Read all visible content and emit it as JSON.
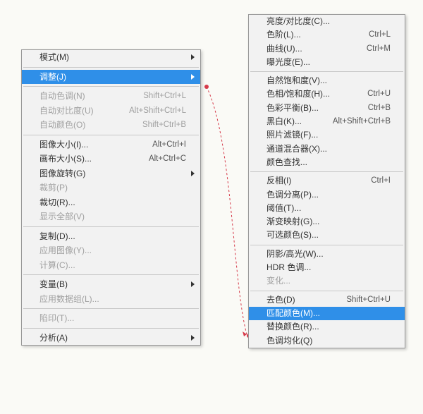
{
  "left_menu": {
    "groups": [
      [
        {
          "label": "模式(M)",
          "shortcut": "",
          "arrow": true,
          "disabled": false,
          "highlight": false,
          "name": "mode-item"
        }
      ],
      [
        {
          "label": "调整(J)",
          "shortcut": "",
          "arrow": true,
          "disabled": false,
          "highlight": true,
          "name": "adjustments-item"
        }
      ],
      [
        {
          "label": "自动色调(N)",
          "shortcut": "Shift+Ctrl+L",
          "arrow": false,
          "disabled": true,
          "highlight": false,
          "name": "auto-tone-item"
        },
        {
          "label": "自动对比度(U)",
          "shortcut": "Alt+Shift+Ctrl+L",
          "arrow": false,
          "disabled": true,
          "highlight": false,
          "name": "auto-contrast-item"
        },
        {
          "label": "自动颜色(O)",
          "shortcut": "Shift+Ctrl+B",
          "arrow": false,
          "disabled": true,
          "highlight": false,
          "name": "auto-color-item"
        }
      ],
      [
        {
          "label": "图像大小(I)...",
          "shortcut": "Alt+Ctrl+I",
          "arrow": false,
          "disabled": false,
          "highlight": false,
          "name": "image-size-item"
        },
        {
          "label": "画布大小(S)...",
          "shortcut": "Alt+Ctrl+C",
          "arrow": false,
          "disabled": false,
          "highlight": false,
          "name": "canvas-size-item"
        },
        {
          "label": "图像旋转(G)",
          "shortcut": "",
          "arrow": true,
          "disabled": false,
          "highlight": false,
          "name": "image-rotation-item"
        },
        {
          "label": "裁剪(P)",
          "shortcut": "",
          "arrow": false,
          "disabled": true,
          "highlight": false,
          "name": "crop-item"
        },
        {
          "label": "裁切(R)...",
          "shortcut": "",
          "arrow": false,
          "disabled": false,
          "highlight": false,
          "name": "trim-item"
        },
        {
          "label": "显示全部(V)",
          "shortcut": "",
          "arrow": false,
          "disabled": true,
          "highlight": false,
          "name": "reveal-all-item"
        }
      ],
      [
        {
          "label": "复制(D)...",
          "shortcut": "",
          "arrow": false,
          "disabled": false,
          "highlight": false,
          "name": "duplicate-item"
        },
        {
          "label": "应用图像(Y)...",
          "shortcut": "",
          "arrow": false,
          "disabled": true,
          "highlight": false,
          "name": "apply-image-item"
        },
        {
          "label": "计算(C)...",
          "shortcut": "",
          "arrow": false,
          "disabled": true,
          "highlight": false,
          "name": "calculations-item"
        }
      ],
      [
        {
          "label": "变量(B)",
          "shortcut": "",
          "arrow": true,
          "disabled": false,
          "highlight": false,
          "name": "variables-item"
        },
        {
          "label": "应用数据组(L)...",
          "shortcut": "",
          "arrow": false,
          "disabled": true,
          "highlight": false,
          "name": "apply-data-set-item"
        }
      ],
      [
        {
          "label": "陷印(T)...",
          "shortcut": "",
          "arrow": false,
          "disabled": true,
          "highlight": false,
          "name": "trap-item"
        }
      ],
      [
        {
          "label": "分析(A)",
          "shortcut": "",
          "arrow": true,
          "disabled": false,
          "highlight": false,
          "name": "analysis-item"
        }
      ]
    ]
  },
  "right_menu": {
    "groups": [
      [
        {
          "label": "亮度/对比度(C)...",
          "shortcut": "",
          "arrow": false,
          "disabled": false,
          "highlight": false,
          "name": "brightness-contrast-item"
        },
        {
          "label": "色阶(L)...",
          "shortcut": "Ctrl+L",
          "arrow": false,
          "disabled": false,
          "highlight": false,
          "name": "levels-item"
        },
        {
          "label": "曲线(U)...",
          "shortcut": "Ctrl+M",
          "arrow": false,
          "disabled": false,
          "highlight": false,
          "name": "curves-item"
        },
        {
          "label": "曝光度(E)...",
          "shortcut": "",
          "arrow": false,
          "disabled": false,
          "highlight": false,
          "name": "exposure-item"
        }
      ],
      [
        {
          "label": "自然饱和度(V)...",
          "shortcut": "",
          "arrow": false,
          "disabled": false,
          "highlight": false,
          "name": "vibrance-item"
        },
        {
          "label": "色相/饱和度(H)...",
          "shortcut": "Ctrl+U",
          "arrow": false,
          "disabled": false,
          "highlight": false,
          "name": "hue-saturation-item"
        },
        {
          "label": "色彩平衡(B)...",
          "shortcut": "Ctrl+B",
          "arrow": false,
          "disabled": false,
          "highlight": false,
          "name": "color-balance-item"
        },
        {
          "label": "黑白(K)...",
          "shortcut": "Alt+Shift+Ctrl+B",
          "arrow": false,
          "disabled": false,
          "highlight": false,
          "name": "black-white-item"
        },
        {
          "label": "照片滤镜(F)...",
          "shortcut": "",
          "arrow": false,
          "disabled": false,
          "highlight": false,
          "name": "photo-filter-item"
        },
        {
          "label": "通道混合器(X)...",
          "shortcut": "",
          "arrow": false,
          "disabled": false,
          "highlight": false,
          "name": "channel-mixer-item"
        },
        {
          "label": "颜色查找...",
          "shortcut": "",
          "arrow": false,
          "disabled": false,
          "highlight": false,
          "name": "color-lookup-item"
        }
      ],
      [
        {
          "label": "反相(I)",
          "shortcut": "Ctrl+I",
          "arrow": false,
          "disabled": false,
          "highlight": false,
          "name": "invert-item"
        },
        {
          "label": "色调分离(P)...",
          "shortcut": "",
          "arrow": false,
          "disabled": false,
          "highlight": false,
          "name": "posterize-item"
        },
        {
          "label": "阈值(T)...",
          "shortcut": "",
          "arrow": false,
          "disabled": false,
          "highlight": false,
          "name": "threshold-item"
        },
        {
          "label": "渐变映射(G)...",
          "shortcut": "",
          "arrow": false,
          "disabled": false,
          "highlight": false,
          "name": "gradient-map-item"
        },
        {
          "label": "可选颜色(S)...",
          "shortcut": "",
          "arrow": false,
          "disabled": false,
          "highlight": false,
          "name": "selective-color-item"
        }
      ],
      [
        {
          "label": "阴影/高光(W)...",
          "shortcut": "",
          "arrow": false,
          "disabled": false,
          "highlight": false,
          "name": "shadows-highlights-item"
        },
        {
          "label": "HDR 色调...",
          "shortcut": "",
          "arrow": false,
          "disabled": false,
          "highlight": false,
          "name": "hdr-toning-item"
        },
        {
          "label": "变化...",
          "shortcut": "",
          "arrow": false,
          "disabled": true,
          "highlight": false,
          "name": "variations-item"
        }
      ],
      [
        {
          "label": "去色(D)",
          "shortcut": "Shift+Ctrl+U",
          "arrow": false,
          "disabled": false,
          "highlight": false,
          "name": "desaturate-item"
        },
        {
          "label": "匹配颜色(M)...",
          "shortcut": "",
          "arrow": false,
          "disabled": false,
          "highlight": true,
          "name": "match-color-item"
        },
        {
          "label": "替换颜色(R)...",
          "shortcut": "",
          "arrow": false,
          "disabled": false,
          "highlight": false,
          "name": "replace-color-item"
        },
        {
          "label": "色调均化(Q)",
          "shortcut": "",
          "arrow": false,
          "disabled": false,
          "highlight": false,
          "name": "equalize-item"
        }
      ]
    ]
  }
}
